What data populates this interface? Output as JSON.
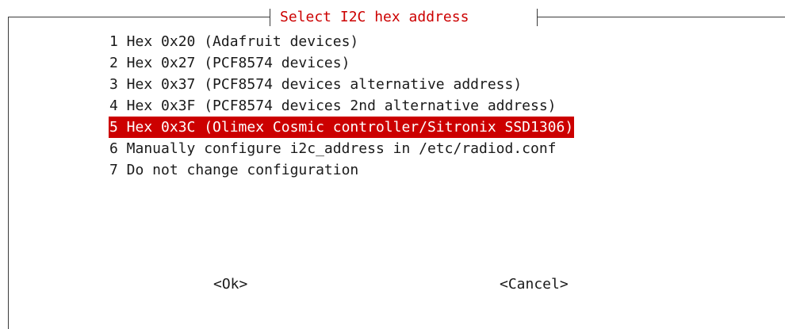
{
  "dialog": {
    "title": "Select I2C hex address",
    "menu_items": [
      {
        "label": "1 Hex 0x20 (Adafruit devices)",
        "selected": false
      },
      {
        "label": "2 Hex 0x27 (PCF8574 devices)",
        "selected": false
      },
      {
        "label": "3 Hex 0x37 (PCF8574 devices alternative address)",
        "selected": false
      },
      {
        "label": "4 Hex 0x3F (PCF8574 devices 2nd alternative address)",
        "selected": false
      },
      {
        "label": "5 Hex 0x3C (Olimex Cosmic controller/Sitronix SSD1306)",
        "selected": true
      },
      {
        "label": "6 Manually configure i2c_address in /etc/radiod.conf",
        "selected": false
      },
      {
        "label": "7 Do not change configuration",
        "selected": false
      }
    ],
    "ok_label": "<Ok>",
    "cancel_label": "<Cancel>"
  },
  "colors": {
    "accent": "#cc0000",
    "text": "#1a1a1a",
    "background": "#ffffff"
  }
}
